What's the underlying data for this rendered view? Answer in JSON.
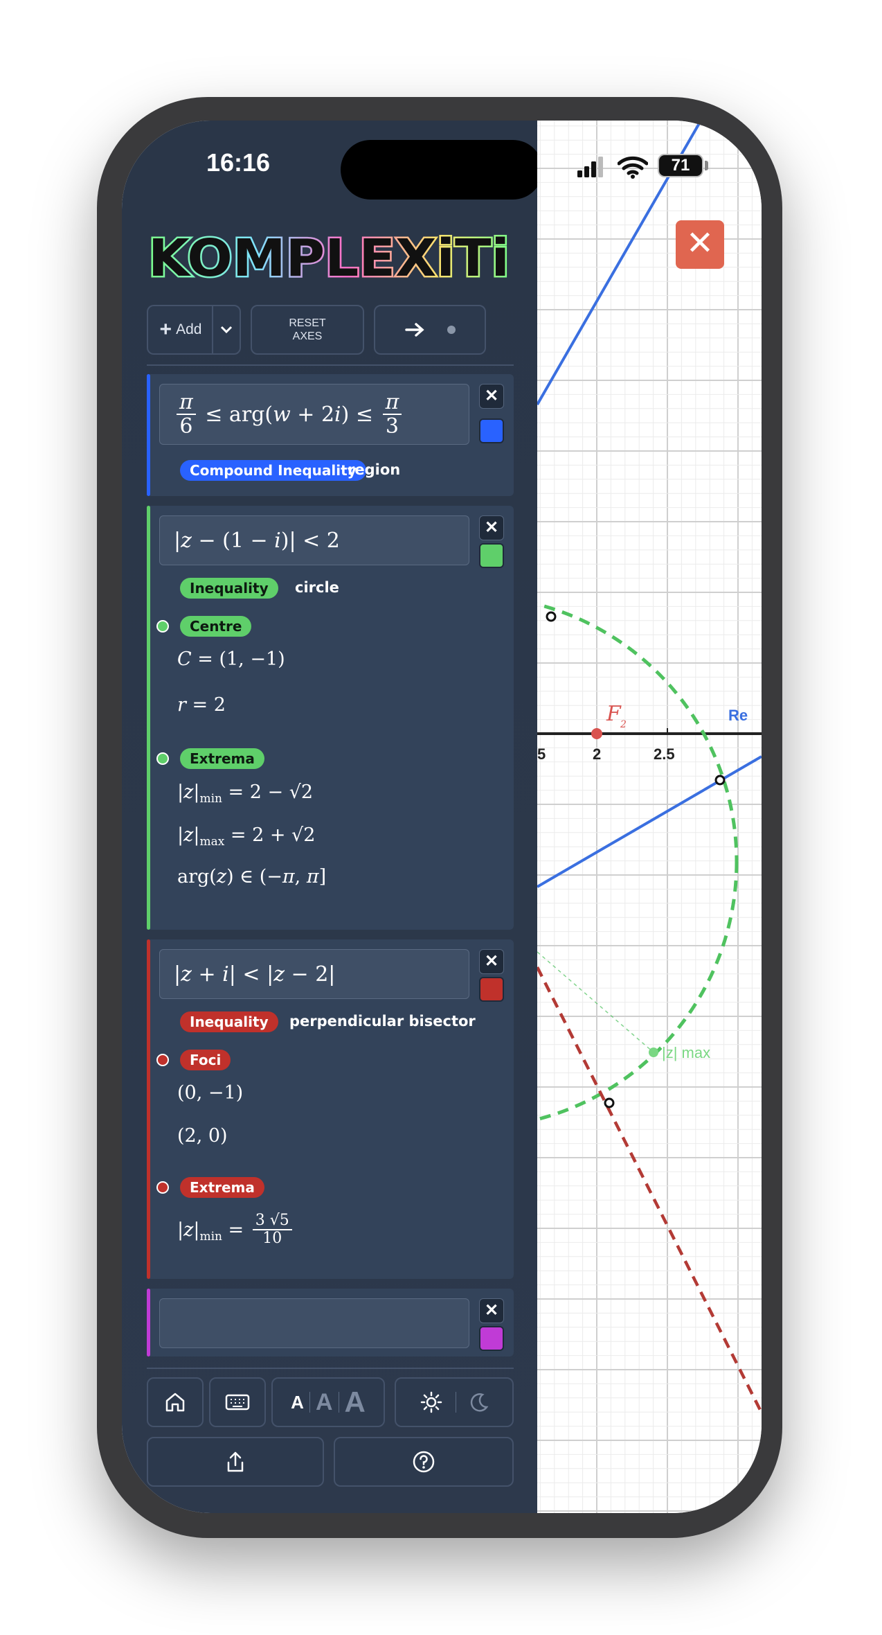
{
  "status": {
    "time": "16:16",
    "battery": "71"
  },
  "app": {
    "name": "KOMPLEXiTi"
  },
  "toolbar": {
    "add_label": "Add",
    "reset_line1": "RESET",
    "reset_line2": "AXES"
  },
  "cards": [
    {
      "expression": "π/6 ≤ arg(w + 2i) ≤ π/3",
      "color": "#2962ff",
      "tag": "Compound Inequality",
      "type_word": "region"
    },
    {
      "expression": "|z − (1 − i)| < 2",
      "color": "#5fcf6a",
      "tag": "Inequality",
      "type_word": "circle",
      "sections": [
        {
          "title": "Centre",
          "lines": [
            "C = (1, −1)",
            "r = 2"
          ]
        },
        {
          "title": "Extrema",
          "lines": [
            "|z|min = 2 − √2",
            "|z|max = 2 + √2",
            "arg(z) ∈ (−π, π]"
          ]
        }
      ]
    },
    {
      "expression": "|z + i| < |z − 2|",
      "color": "#c0312b",
      "tag": "Inequality",
      "type_word": "perpendicular bisector",
      "sections": [
        {
          "title": "Foci",
          "lines": [
            "(0, −1)",
            "(2, 0)"
          ]
        },
        {
          "title": "Extrema",
          "lines": [
            "|z|min = 3√5 / 10"
          ]
        }
      ]
    },
    {
      "expression": "",
      "color": "#c03bd6"
    }
  ],
  "plot": {
    "axis_label": "Re",
    "tick_labels": [
      "5",
      "2",
      "2.5"
    ],
    "focus_label": "F",
    "focus_subscript": "2",
    "annotation": "|z| max",
    "colors": {
      "region": "#3a6fe0",
      "circle": "#4fc25f",
      "bisector": "#b33a35",
      "focus": "#d9534f"
    }
  },
  "bottom": {
    "font_sizes": [
      "A",
      "A",
      "A"
    ]
  }
}
